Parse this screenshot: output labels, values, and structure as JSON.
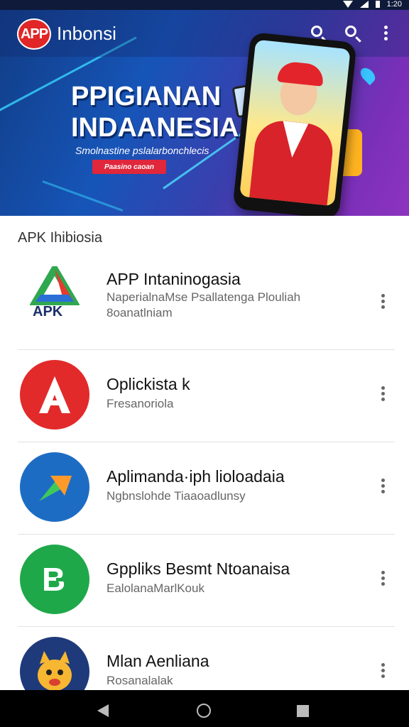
{
  "status_bar": {
    "time": "1:20"
  },
  "header": {
    "logo_text": "APP",
    "brand": "Inbonsi",
    "icons": [
      "search-icon",
      "search-icon",
      "more-vert-icon"
    ]
  },
  "banner": {
    "title_line1": "PPIGIANAN",
    "title_line2": "INDAANESIA",
    "subtitle": "Smolnastine pslalarbonchlecis",
    "button_label": "Paasino caoan"
  },
  "section": {
    "title": "APK Ihibiosia"
  },
  "apps": [
    {
      "name": "APP Intaninogasia",
      "description": "NaperialnaMse Psallatenga Plouliah 8oanatlniam",
      "icon": "apk-triangle-logo-icon"
    },
    {
      "name": "Oplickista k",
      "description": "Fresanoriola",
      "icon": "red-a-logo-icon"
    },
    {
      "name": "Aplimanda·iph lioloadaia",
      "description": "Ngbnslohde Tiaaoadlunsy",
      "icon": "blue-arrow-logo-icon"
    },
    {
      "name": "Gppliks Besmt Ntoanaisa",
      "description": "EalolanaMarlKouk",
      "icon": "green-b-logo-icon"
    },
    {
      "name": "Mlan Aenliana",
      "description": "Rosanalalak",
      "icon": "cartoon-cat-icon"
    }
  ],
  "colors": {
    "header_bg": "#113d86",
    "accent_red": "#e02626",
    "nav_bg": "#000000"
  }
}
